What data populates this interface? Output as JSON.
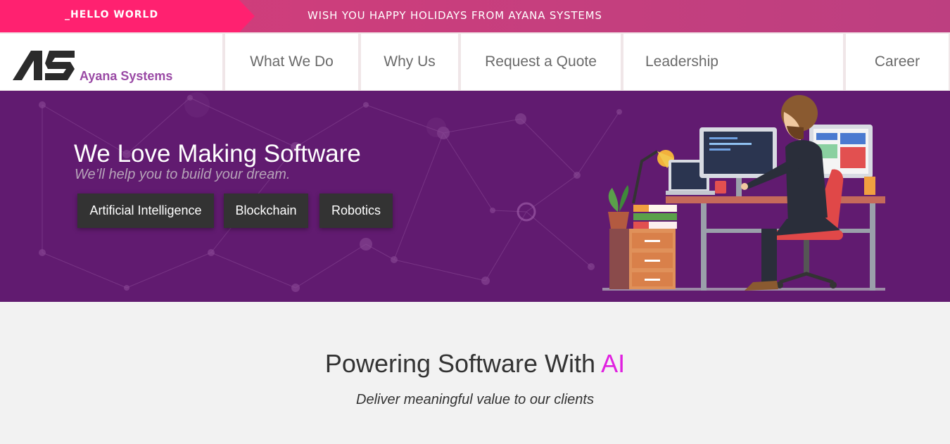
{
  "topbar": {
    "hello_label": "_HELLO WORLD",
    "greeting": "WISH YOU HAPPY HOLIDAYS FROM AYANA SYSTEMS",
    "colors": {
      "hello_bg": "#ff2170",
      "bar_bg": "#c83f7d"
    }
  },
  "brand": {
    "name": "Ayana Systems",
    "color": "#9a4aa5",
    "logo_icon": "as-monogram-icon"
  },
  "nav": {
    "items": [
      {
        "label": "What We Do"
      },
      {
        "label": "Why Us"
      },
      {
        "label": "Request a Quote"
      },
      {
        "label": "Leadership"
      },
      {
        "label": "Career"
      }
    ]
  },
  "hero": {
    "title": "We Love Making Software",
    "subtitle": "We’ll help you to build your dream.",
    "tags": [
      "Artificial Intelligence",
      "Blockchain",
      "Robotics"
    ],
    "background": "#611b70",
    "illustration": "developer-at-desk-illustration"
  },
  "section": {
    "title_main": "Powering Software With ",
    "title_accent": "AI",
    "accent_color": "#e020e0",
    "subtitle": "Deliver meaningful value to our clients"
  }
}
